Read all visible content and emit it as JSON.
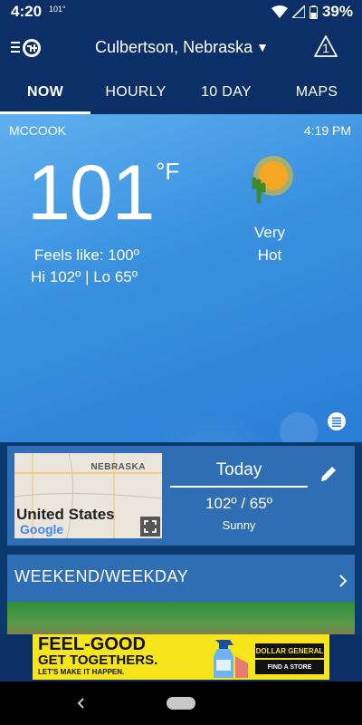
{
  "status_bar": {
    "time": "4:20",
    "temp": "101°",
    "battery": "39%"
  },
  "header": {
    "location": "Culbertson, Nebraska",
    "alert_count": "1"
  },
  "tabs": [
    {
      "label": "NOW",
      "active": true
    },
    {
      "label": "HOURLY",
      "active": false
    },
    {
      "label": "10 DAY",
      "active": false
    },
    {
      "label": "MAPS",
      "active": false
    }
  ],
  "current": {
    "station": "MCCOOK",
    "time": "4:19 PM",
    "temperature": "101",
    "unit": "°F",
    "feels_like": "Feels like: 100º",
    "hi_lo": "Hi 102º | Lo 65º",
    "condition_line1": "Very",
    "condition_line2": "Hot",
    "condition_icon": "hot-sun-cactus-icon"
  },
  "today_card": {
    "map_state": "NEBRASKA",
    "map_country": "United States",
    "map_logo": "Google",
    "label": "Today",
    "hi_lo": "102º / 65º",
    "condition": "Sunny"
  },
  "weekend_card": {
    "title": "WEEKEND/WEEKDAY"
  },
  "ad": {
    "headline_line1": "FEEL-GOOD",
    "headline_line2": "GET TOGETHERS.",
    "subline": "LET'S MAKE IT HAPPEN.",
    "brand": "DOLLAR GENERAL",
    "cta": "FIND A STORE"
  },
  "colors": {
    "header_bg": "#0b2f66",
    "card_bg": "#2f6eb4",
    "sky": "#3b92e0",
    "ad_yellow": "#f7e51b"
  }
}
